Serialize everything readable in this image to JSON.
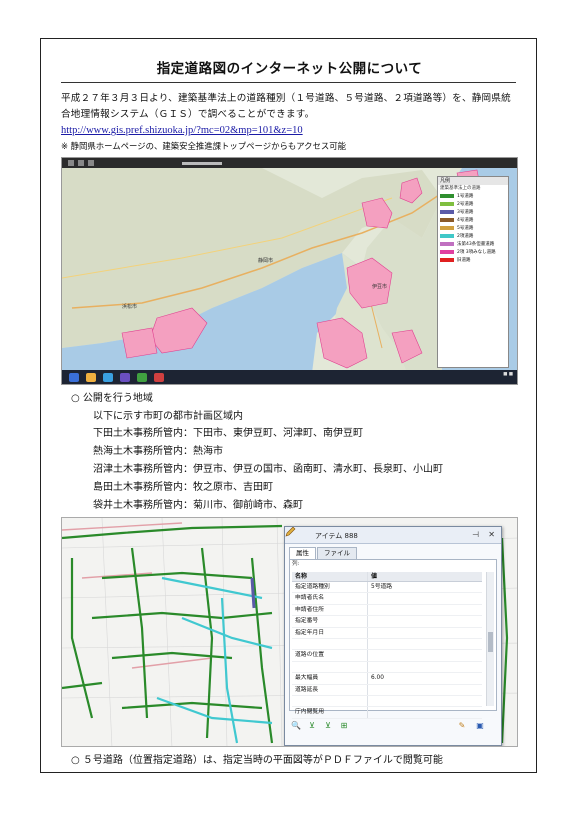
{
  "title": "指定道路図のインターネット公開について",
  "intro": "平成２７年３月３日より、建築基準法上の道路種別（１号道路、５号道路、２項道路等）を、静岡県統合地理情報システム（ＧＩＳ）で調べることができます。",
  "url": "http://www.gis.pref.shizuoka.jp/?mc=02&mp=101&z=10",
  "note": "※ 静岡県ホームページの、建築安全推進課トップページからもアクセス可能",
  "map1": {
    "legend_header": "凡例",
    "legend_title": "建築基準法上の道路",
    "legend": [
      {
        "label": "1号道路",
        "color": "#2f8f2f"
      },
      {
        "label": "2号道路",
        "color": "#7fbf3f"
      },
      {
        "label": "3号道路",
        "color": "#5a5aa8"
      },
      {
        "label": "4号道路",
        "color": "#8a5a2a"
      },
      {
        "label": "5号道路",
        "color": "#d0a040"
      },
      {
        "label": "2項道路",
        "color": "#40c8c8"
      },
      {
        "label": "法第43条但書道路",
        "color": "#c070c0"
      },
      {
        "label": "2項 3項みなし道路",
        "color": "#e040a0"
      },
      {
        "label": "旧道路",
        "color": "#e02020"
      }
    ],
    "place_labels": [
      "静岡市",
      "伊豆市",
      "浜松市"
    ]
  },
  "section_heading": "○ 公開を行う地域",
  "section_sub": "以下に示す市町の都市計画区域内",
  "areas": [
    {
      "office": "下田土木事務所管内：",
      "towns": "下田市、東伊豆町、河津町、南伊豆町"
    },
    {
      "office": "熱海土木事務所管内：",
      "towns": "熱海市"
    },
    {
      "office": "沼津土木事務所管内：",
      "towns": "伊豆市、伊豆の国市、函南町、清水町、長泉町、小山町"
    },
    {
      "office": "島田土木事務所管内：",
      "towns": "牧之原市、吉田町"
    },
    {
      "office": "袋井土木事務所管内：",
      "towns": "菊川市、御前崎市、森町"
    }
  ],
  "panel": {
    "title": "アイテム 888",
    "tabs": [
      "属性",
      "ファイル"
    ],
    "list_label": "列:",
    "col_name": "名称",
    "col_value": "値",
    "rows": [
      {
        "name": "指定道路種別",
        "value": "5号道路"
      },
      {
        "name": "申請者氏名",
        "value": ""
      },
      {
        "name": "申請者住所",
        "value": ""
      },
      {
        "name": "指定番号",
        "value": ""
      },
      {
        "name": "指定年月日",
        "value": ""
      },
      {
        "name": "",
        "value": ""
      },
      {
        "name": "道路の位置",
        "value": ""
      },
      {
        "name": "",
        "value": ""
      },
      {
        "name": "最大幅員",
        "value": "6.00"
      },
      {
        "name": "道路延長",
        "value": ""
      },
      {
        "name": "",
        "value": ""
      },
      {
        "name": "庁内閲覧用",
        "value": ""
      }
    ]
  },
  "caption": "○ ５号道路（位置指定道路）は、指定当時の平面図等がＰＤＦファイルで閲覧可能"
}
